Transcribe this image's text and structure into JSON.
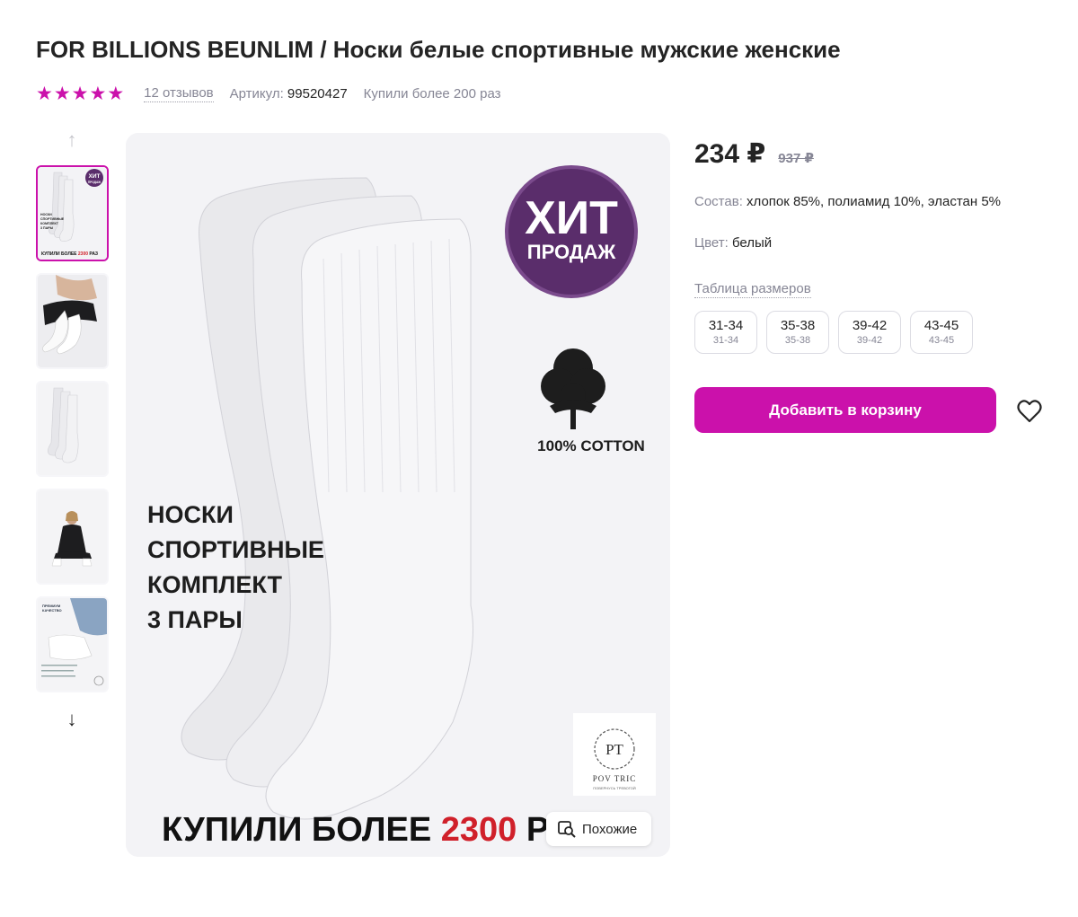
{
  "product": {
    "title": "FOR BILLIONS BEUNLIM / Носки белые спортивные мужские женские",
    "rating_stars": 5,
    "reviews_label": "12 отзывов",
    "article_label": "Артикул:",
    "article_value": "99520427",
    "bought_label": "Купили более 200 раз"
  },
  "gallery": {
    "active_index": 0,
    "main_image": {
      "badge_line1": "ХИТ",
      "badge_line2": "ПРОДАЖ",
      "cotton_label": "100% COTTON",
      "text_lines": [
        "НОСКИ",
        "СПОРТИВНЫЕ",
        "КОМПЛЕКТ",
        "3 ПАРЫ"
      ],
      "bottom_text": "КУПИЛИ БОЛЕЕ",
      "bottom_number": "2300",
      "bottom_suffix": "РАЗ",
      "logo_initials": "PT",
      "logo_name": "POV TRIC",
      "logo_subtitle": "ПОВЕРНУСЬ ТРЕВОГОЙ"
    },
    "thumb1": {
      "badge_line1": "ХИТ",
      "badge_line2": "ПРОДАЖ",
      "lines": [
        "НОСКИ",
        "СПОРТИВНЫЕ",
        "КОМПЛЕКТ",
        "3 ПАРЫ"
      ],
      "bottom_text": "КУПИЛИ БОЛЕЕ",
      "bottom_number": "2300",
      "bottom_suffix": "РАЗ"
    },
    "thumb5": {
      "lines": [
        "ПРЕМИУМ",
        "КАЧЕСТВО"
      ]
    },
    "similar_label": "Похожие"
  },
  "pricing": {
    "price": "234 ₽",
    "old_price": "937 ₽"
  },
  "properties": {
    "composition_label": "Состав:",
    "composition_value": "хлопок 85%, полиамид 10%, эластан 5%",
    "color_label": "Цвет:",
    "color_value": "белый"
  },
  "sizes": {
    "table_label": "Таблица размеров",
    "items": [
      {
        "label": "31-34",
        "sub": "31-34"
      },
      {
        "label": "35-38",
        "sub": "35-38"
      },
      {
        "label": "39-42",
        "sub": "39-42"
      },
      {
        "label": "43-45",
        "sub": "43-45"
      }
    ]
  },
  "actions": {
    "add_to_cart": "Добавить в корзину"
  },
  "colors": {
    "accent": "#cb11ab",
    "badge_purple": "#5a2d6b",
    "red_number": "#d0202a"
  }
}
